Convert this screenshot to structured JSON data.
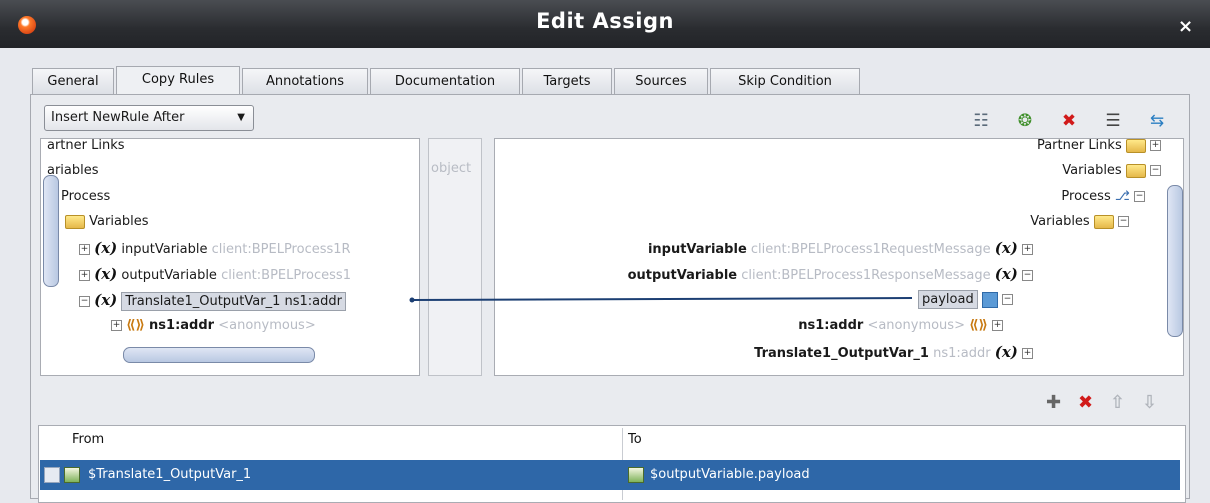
{
  "window": {
    "title": "Edit Assign",
    "close_glyph": "×",
    "app_icon": "oracle-app-icon"
  },
  "tabs": [
    "General",
    "Copy Rules",
    "Annotations",
    "Documentation",
    "Targets",
    "Sources",
    "Skip Condition"
  ],
  "active_tab": "Copy Rules",
  "insert_mode": {
    "value": "Insert NewRule After",
    "arrow": "▼"
  },
  "toolbar": {
    "icons": [
      "expression-builder-icon",
      "xml-fragment-icon",
      "delete-rule-icon",
      "xpath-icon",
      "bulk-assign-icon"
    ],
    "glyphs": [
      "☷",
      "❂",
      "✖",
      "☰",
      "⇆"
    ]
  },
  "left_tree": {
    "partner_links": "artner Links",
    "variables_root": "ariables",
    "process": "Process",
    "variables": "Variables",
    "input_var": {
      "name": "inputVariable",
      "type": "client:BPELProcess1R"
    },
    "output_var": {
      "name": "outputVariable",
      "type": "client:BPELProcess1"
    },
    "translate_var": {
      "name": "Translate1_OutputVar_1 ns1:addr"
    },
    "ns1_addr": {
      "name": "ns1:addr",
      "type": "<anonymous>"
    }
  },
  "center": {
    "label": "object"
  },
  "right_tree": {
    "partner_links": "Partner Links",
    "variables_root": "Variables",
    "process": "Process",
    "variables": "Variables",
    "input_var": {
      "name": "inputVariable",
      "type": "client:BPELProcess1RequestMessage"
    },
    "output_var": {
      "name": "outputVariable",
      "type": "client:BPELProcess1ResponseMessage"
    },
    "payload": "payload",
    "ns1_addr": {
      "name": "ns1:addr",
      "type": "<anonymous>"
    },
    "translate_var": {
      "name": "Translate1_OutputVar_1",
      "type": "ns1:addr"
    }
  },
  "rule_actions": {
    "glyphs": [
      "✚",
      "✖",
      "⇧",
      "⇩"
    ]
  },
  "copy_rules_table": {
    "columns": [
      "From",
      "To"
    ],
    "rows": [
      {
        "from": "$Translate1_OutputVar_1",
        "to": "$outputVariable.payload"
      }
    ]
  },
  "colors": {
    "selection": "#2e67a8",
    "mapping_line": "#1c3f73",
    "delete": "#d11a1a"
  }
}
